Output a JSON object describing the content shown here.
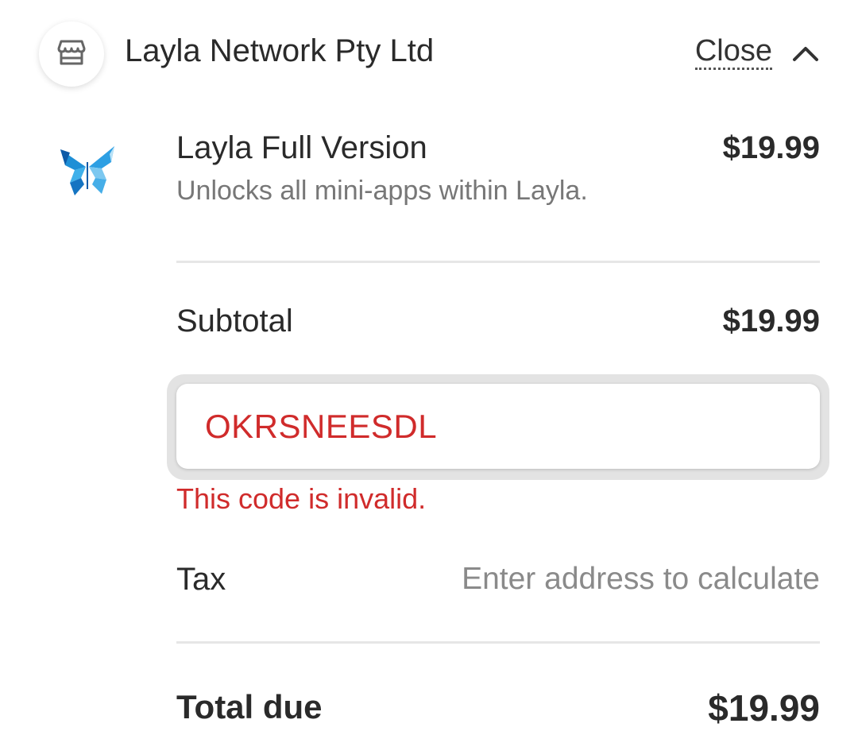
{
  "header": {
    "merchant_name": "Layla Network Pty Ltd",
    "merchant_icon": "store-icon",
    "close_label": "Close",
    "collapse_icon": "chevron-up-icon"
  },
  "product": {
    "logo": "butterfly-logo",
    "name": "Layla Full Version",
    "description": "Unlocks all mini-apps within Layla.",
    "price": "$19.99"
  },
  "summary": {
    "subtotal_label": "Subtotal",
    "subtotal_value": "$19.99",
    "promo_code_value": "OKRSNEESDL",
    "promo_error": "This code is invalid.",
    "tax_label": "Tax",
    "tax_value": "Enter address to calculate",
    "total_label": "Total due",
    "total_value": "$19.99"
  },
  "colors": {
    "error": "#d02b2b",
    "brand_blue": "#1e8fd6"
  }
}
